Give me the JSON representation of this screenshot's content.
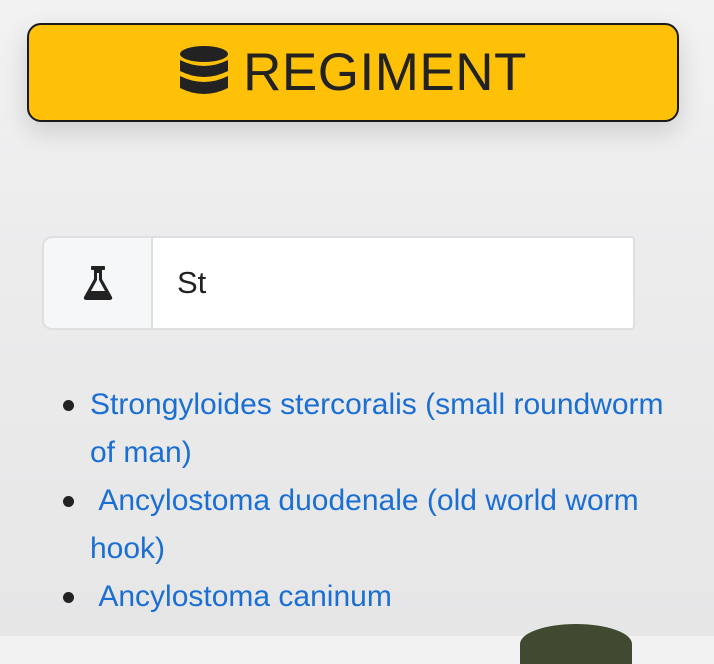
{
  "header": {
    "title": "REGIMENT",
    "icon": "database-icon",
    "background_color": "#ffc107"
  },
  "search": {
    "icon": "flask-icon",
    "value": "St"
  },
  "results": [
    {
      "label": "Strongyloides stercoralis (small roundworm of man)"
    },
    {
      "label": " Ancylostoma duodenale (old world worm hook)"
    },
    {
      "label": " Ancylostoma caninum"
    }
  ],
  "colors": {
    "link": "#1a6fd4",
    "border": "#dedfe1"
  }
}
